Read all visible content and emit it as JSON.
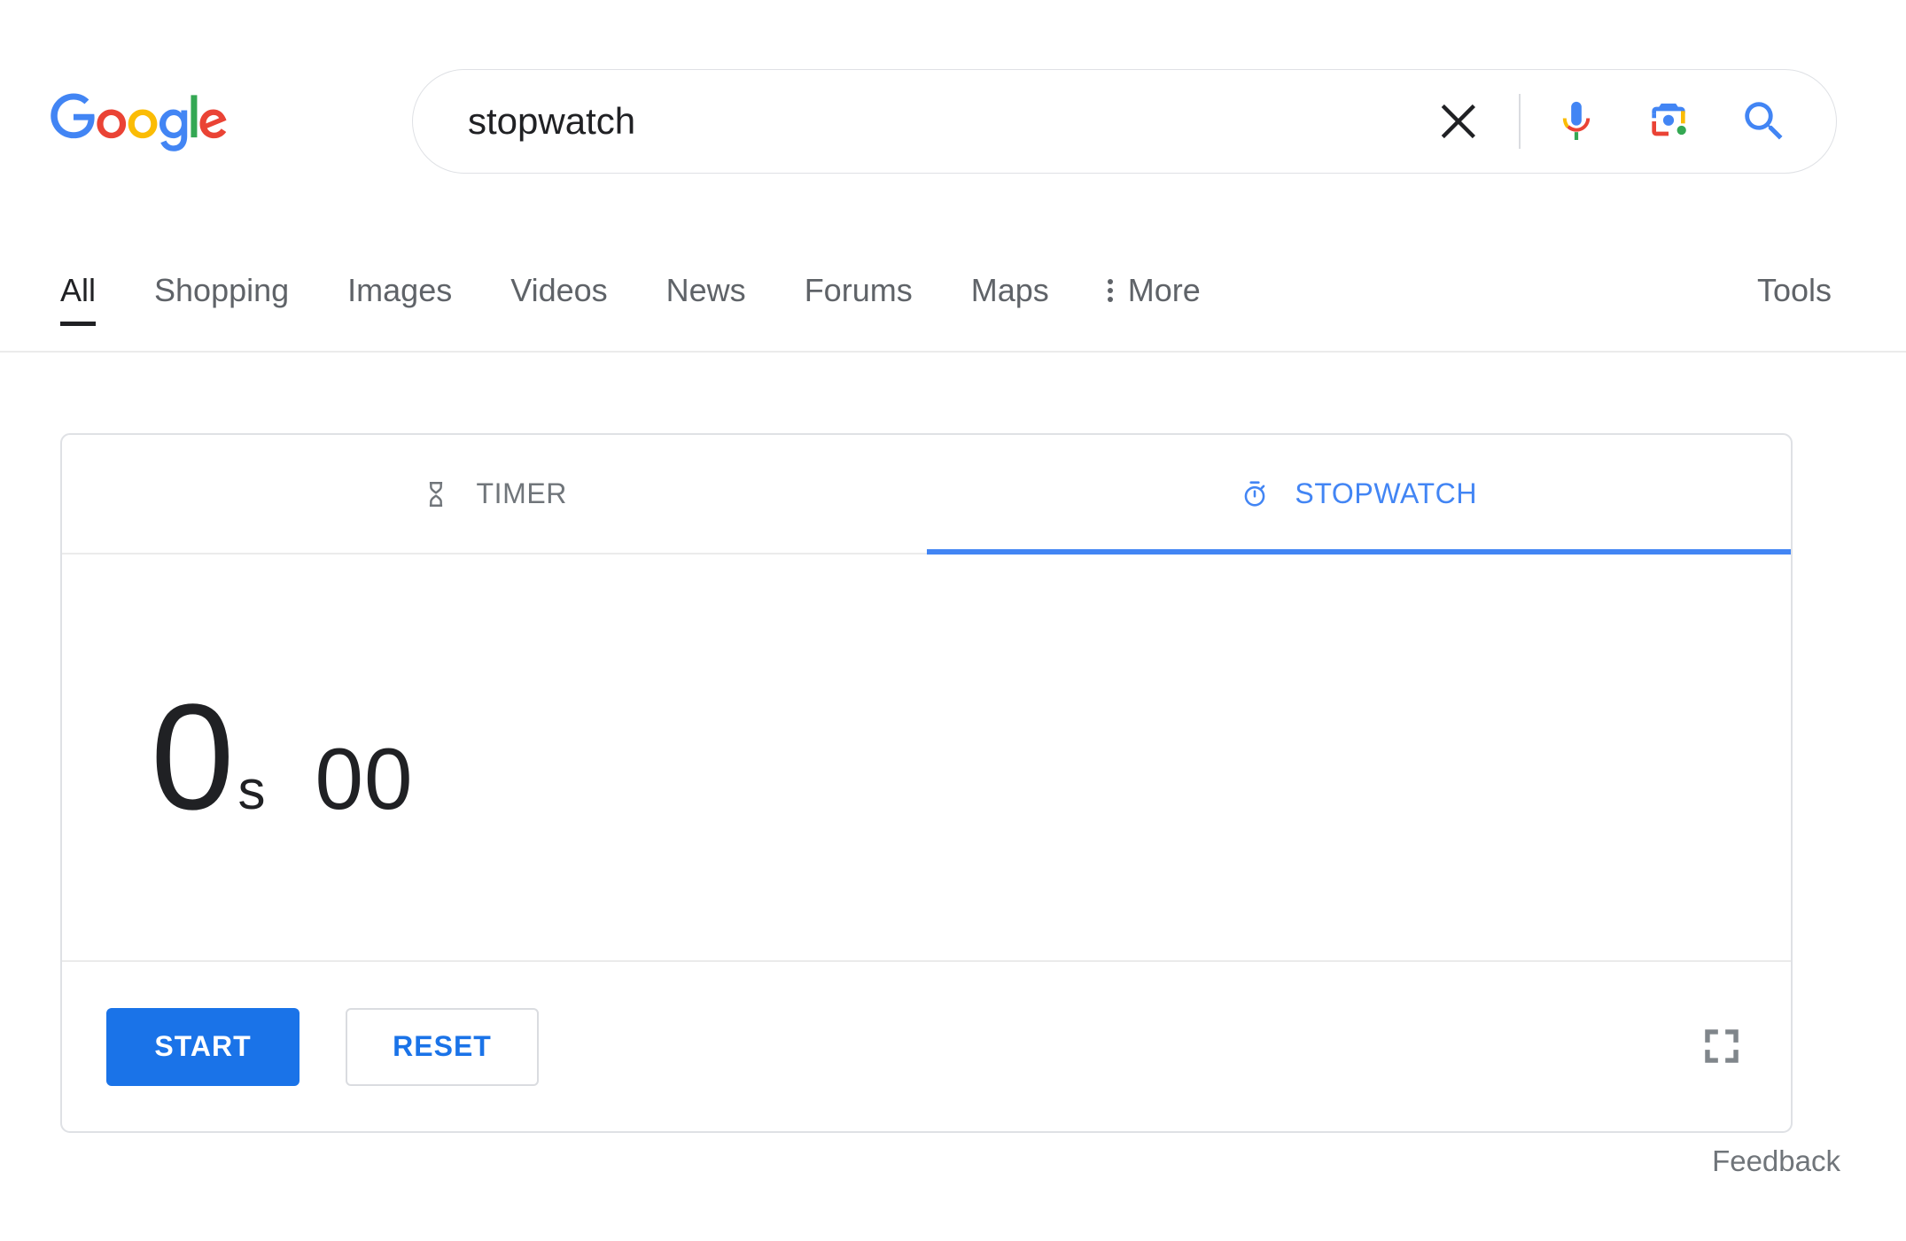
{
  "brand": {
    "name": "Google",
    "letters": [
      {
        "char": "G",
        "color": "#4285F4"
      },
      {
        "char": "o",
        "color": "#EA4335"
      },
      {
        "char": "o",
        "color": "#FBBC05"
      },
      {
        "char": "g",
        "color": "#4285F4"
      },
      {
        "char": "l",
        "color": "#34A853"
      },
      {
        "char": "e",
        "color": "#EA4335"
      }
    ]
  },
  "search": {
    "query": "stopwatch",
    "placeholder": "Search",
    "clear_icon": "close-icon",
    "mic_icon": "microphone-icon",
    "lens_icon": "google-lens-camera-icon",
    "search_icon": "magnifier-icon"
  },
  "nav": {
    "items": [
      {
        "label": "All",
        "active": true
      },
      {
        "label": "Shopping",
        "active": false
      },
      {
        "label": "Images",
        "active": false
      },
      {
        "label": "Videos",
        "active": false
      },
      {
        "label": "News",
        "active": false
      },
      {
        "label": "Forums",
        "active": false
      },
      {
        "label": "Maps",
        "active": false
      }
    ],
    "more_label": "More",
    "more_icon": "vertical-dots-icon",
    "tools_label": "Tools"
  },
  "widget": {
    "tabs": [
      {
        "label": "TIMER",
        "icon": "hourglass-icon",
        "active": false
      },
      {
        "label": "STOPWATCH",
        "icon": "stopwatch-icon",
        "active": true
      }
    ],
    "display": {
      "seconds": "0",
      "unit": "s",
      "centiseconds": "00"
    },
    "controls": {
      "start_label": "START",
      "reset_label": "RESET",
      "fullscreen_icon": "fullscreen-icon"
    }
  },
  "footer": {
    "feedback_label": "Feedback"
  },
  "colors": {
    "accent_blue": "#4285f4",
    "button_blue": "#1a73e8",
    "text_primary": "#202124",
    "text_secondary": "#5f6368",
    "border": "#dfe1e5"
  }
}
